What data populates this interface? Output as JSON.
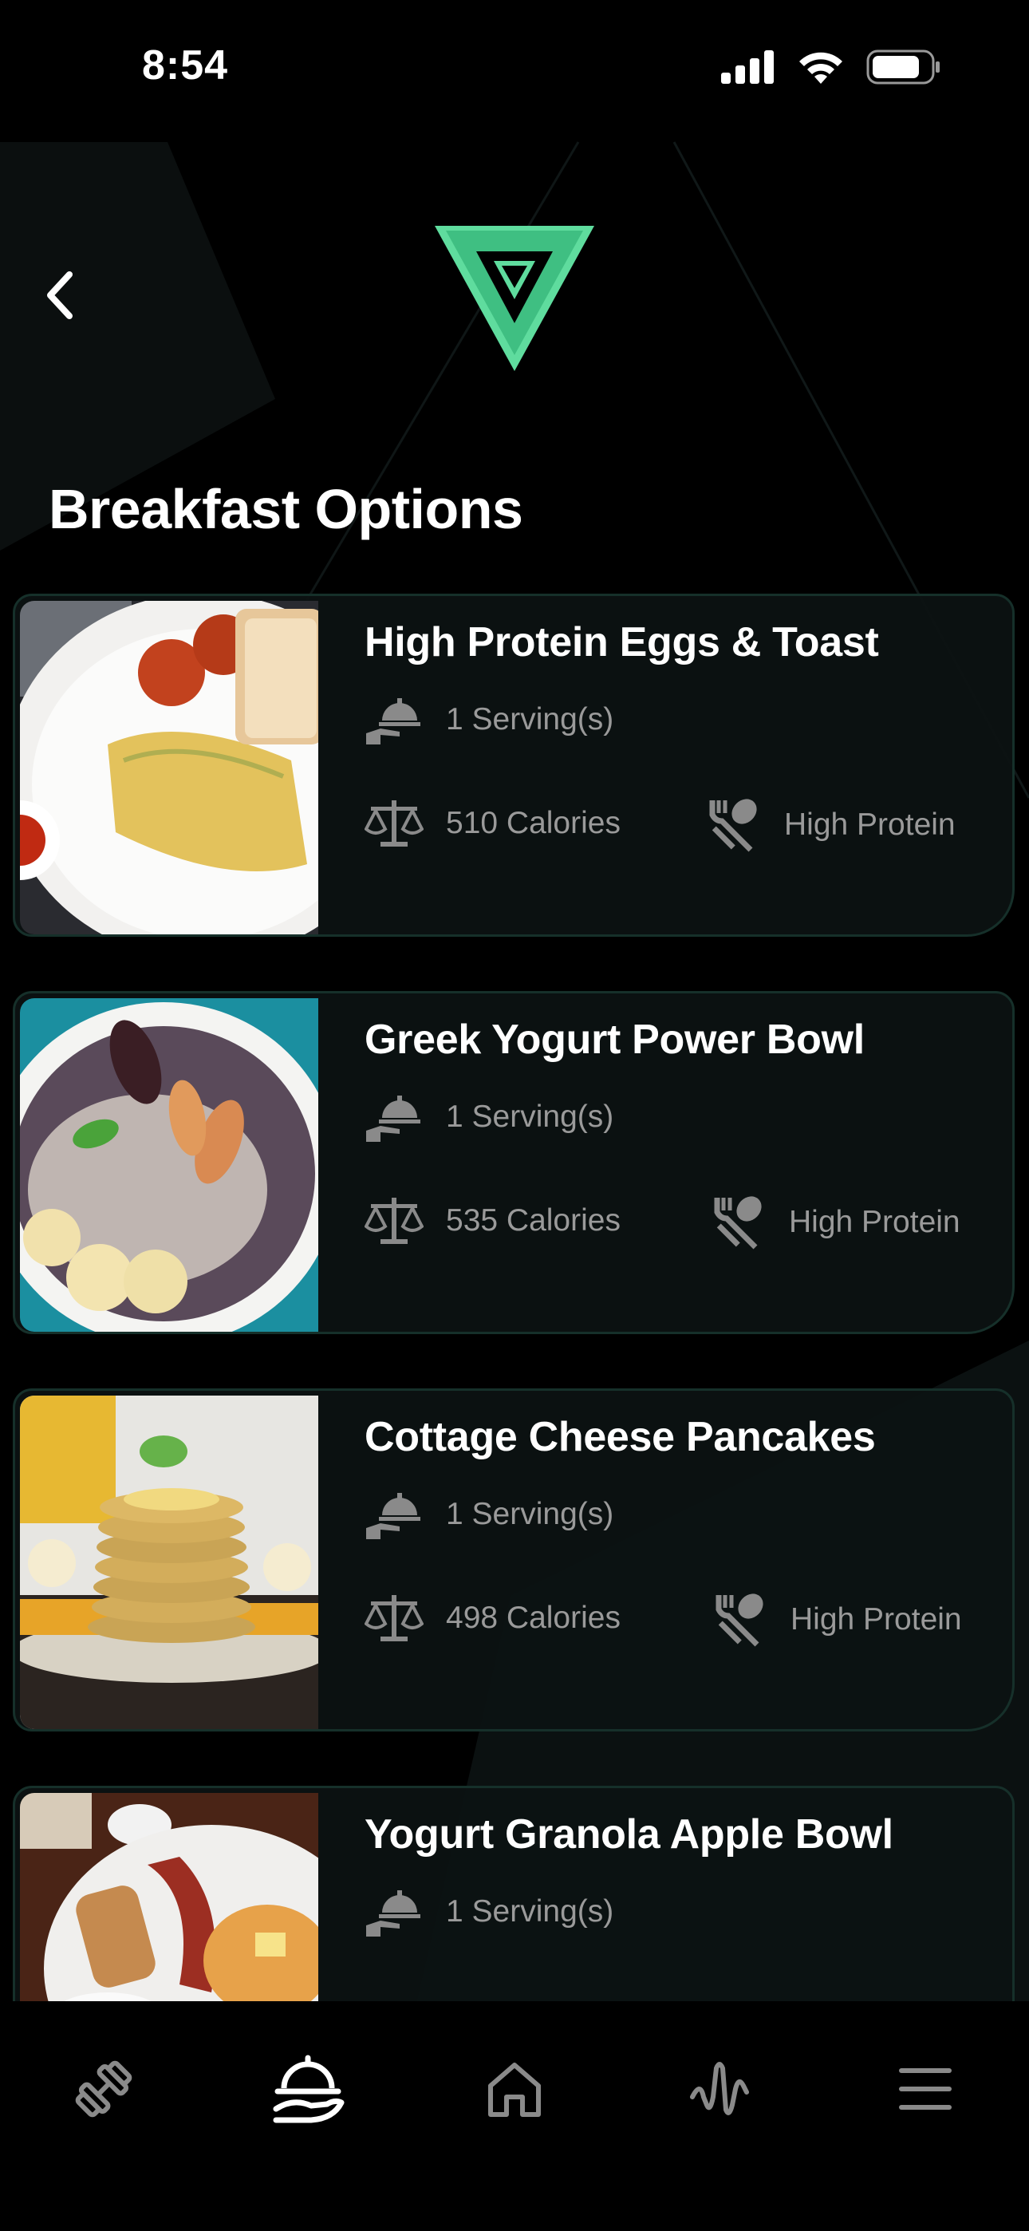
{
  "status_bar": {
    "time": "8:54",
    "icons": [
      "signal-icon",
      "wifi-icon",
      "battery-icon"
    ]
  },
  "header": {
    "back_icon": "chevron-left-icon",
    "logo": "brand-triangle-logo"
  },
  "page_title": "Breakfast Options",
  "colors": {
    "background": "#000000",
    "accent": "#5fdc9e",
    "muted_text": "#9a9a9a",
    "card_border": "#16302a"
  },
  "meals": [
    {
      "title": "High Protein Eggs & Toast",
      "servings": "1 Serving(s)",
      "calories": "510 Calories",
      "tag": "High Protein",
      "photo": "eggs-and-toast-plate"
    },
    {
      "title": "Greek Yogurt Power Bowl",
      "servings": "1 Serving(s)",
      "calories": "535 Calories",
      "tag": "High Protein",
      "photo": "yogurt-bowl"
    },
    {
      "title": "Cottage Cheese Pancakes",
      "servings": "1 Serving(s)",
      "calories": "498 Calories",
      "tag": "High Protein",
      "photo": "pancake-stack"
    },
    {
      "title": "Yogurt Granola Apple Bowl",
      "servings": "1 Serving(s)",
      "calories": "",
      "tag": "",
      "photo": "bacon-pancake-plate"
    }
  ],
  "tab_bar": {
    "items": [
      {
        "icon": "dumbbell-icon",
        "active": false
      },
      {
        "icon": "food-tray-icon",
        "active": true
      },
      {
        "icon": "home-icon",
        "active": false
      },
      {
        "icon": "activity-wave-icon",
        "active": false
      },
      {
        "icon": "menu-icon",
        "active": false
      }
    ]
  }
}
